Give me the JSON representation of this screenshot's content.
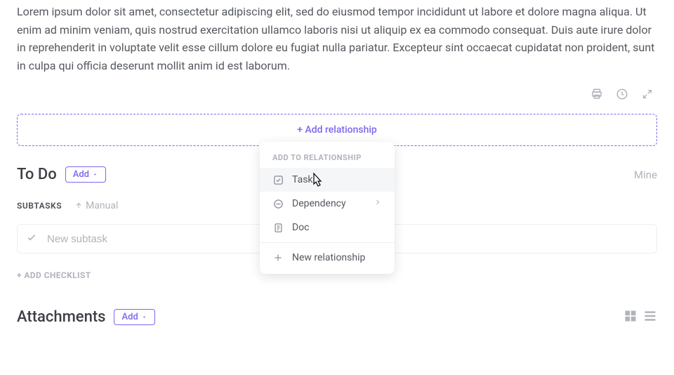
{
  "description": "Lorem ipsum dolor sit amet, consectetur adipiscing elit, sed do eiusmod tempor incididunt ut labore et dolore magna aliqua. Ut enim ad minim veniam, quis nostrud exercitation ullamco laboris nisi ut aliquip ex ea commodo consequat. Duis aute irure dolor in reprehenderit in voluptate velit esse cillum dolore eu fugiat nulla pariatur. Excepteur sint occaecat cupidatat non proident, sunt in culpa qui officia deserunt mollit anim id est laborum.",
  "relationship": {
    "add_label": "+ Add relationship"
  },
  "todo": {
    "title": "To Do",
    "add_label": "Add",
    "mine_label": "Mine"
  },
  "subtasks": {
    "label": "SUBTASKS",
    "sort_label": "Manual",
    "new_placeholder": "New subtask"
  },
  "checklist": {
    "add_label": "+ ADD CHECKLIST"
  },
  "attachments": {
    "title": "Attachments",
    "add_label": "Add"
  },
  "popup": {
    "header": "ADD TO RELATIONSHIP",
    "items": {
      "task": "Task",
      "dependency": "Dependency",
      "doc": "Doc",
      "new": "New relationship"
    }
  }
}
